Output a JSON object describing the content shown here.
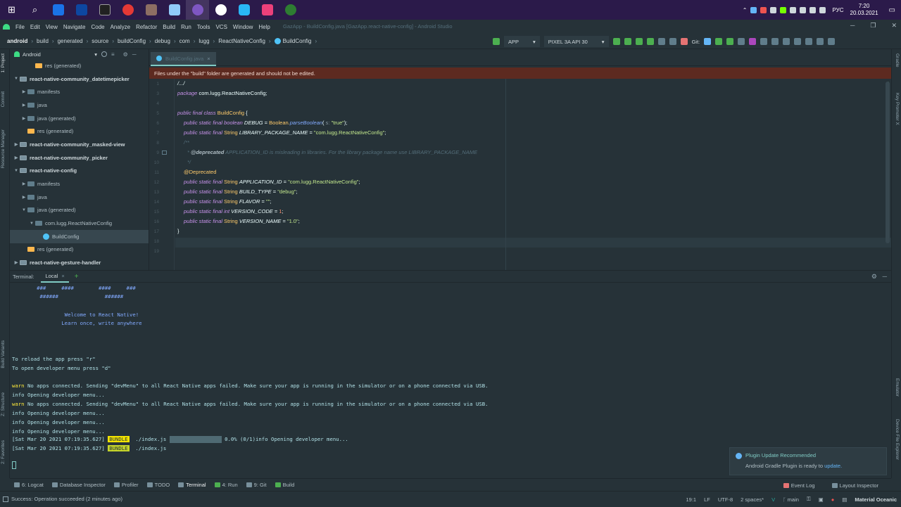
{
  "taskbar": {
    "apps": [
      "windows-start",
      "search",
      "chrome-frame",
      "visual-studio",
      "terminal",
      "chrome",
      "android-studio-2",
      "photos",
      "android-studio",
      "yandex-browser",
      "skype",
      "game-app",
      "chrome-green"
    ],
    "language": "РУС",
    "time": "7:20",
    "date": "20.03.2021"
  },
  "menu": {
    "items": [
      "File",
      "Edit",
      "View",
      "Navigate",
      "Code",
      "Analyze",
      "Refactor",
      "Build",
      "Run",
      "Tools",
      "VCS",
      "Window",
      "Help"
    ],
    "window_title": "GazApp - BuildConfig.java [GazApp.react-native-config] - Android Studio"
  },
  "breadcrumb": [
    "android",
    "build",
    "generated",
    "source",
    "buildConfig",
    "debug",
    "com",
    "lugg",
    "ReactNativeConfig",
    "BuildConfig"
  ],
  "toolbar": {
    "run_config": "APP",
    "device": "PIXEL 3A API 30",
    "git_label": "Git:"
  },
  "left_strip": {
    "project": "1: Project",
    "commit": "Commit",
    "resource_manager": "Resource Manager",
    "build_variants": "Build Variants",
    "structure": "Z: Structure",
    "favorites": "2: Favorites"
  },
  "right_strip": {
    "gradle": "Gradle",
    "key_promoter": "Key Promoter X",
    "emulator": "Emulator",
    "device_explorer": "Device File Explorer"
  },
  "project": {
    "view": "Android",
    "tree": [
      {
        "label": "res (generated)",
        "type": "res",
        "level": 2,
        "arrow": ""
      },
      {
        "label": "react-native-community_datetimepicker",
        "type": "mod",
        "level": 0,
        "arrow": "▼",
        "bold": true
      },
      {
        "label": "manifests",
        "type": "folder",
        "level": 1,
        "arrow": "▶"
      },
      {
        "label": "java",
        "type": "folder",
        "level": 1,
        "arrow": "▶"
      },
      {
        "label": "java (generated)",
        "type": "folder",
        "level": 1,
        "arrow": "▶"
      },
      {
        "label": "res (generated)",
        "type": "res",
        "level": 1,
        "arrow": ""
      },
      {
        "label": "react-native-community_masked-view",
        "type": "mod",
        "level": 0,
        "arrow": "▶",
        "bold": true
      },
      {
        "label": "react-native-community_picker",
        "type": "mod",
        "level": 0,
        "arrow": "▶",
        "bold": true
      },
      {
        "label": "react-native-config",
        "type": "mod",
        "level": 0,
        "arrow": "▼",
        "bold": true
      },
      {
        "label": "manifests",
        "type": "folder",
        "level": 1,
        "arrow": "▶"
      },
      {
        "label": "java",
        "type": "folder",
        "level": 1,
        "arrow": "▶"
      },
      {
        "label": "java (generated)",
        "type": "folder",
        "level": 1,
        "arrow": "▼"
      },
      {
        "label": "com.lugg.ReactNativeConfig",
        "type": "folder",
        "level": 2,
        "arrow": "▼"
      },
      {
        "label": "BuildConfig",
        "type": "class",
        "level": 3,
        "arrow": "",
        "selected": true
      },
      {
        "label": "res (generated)",
        "type": "res",
        "level": 1,
        "arrow": ""
      },
      {
        "label": "react-native-gesture-handler",
        "type": "mod",
        "level": 0,
        "arrow": "▶",
        "bold": true
      }
    ]
  },
  "editor": {
    "tab": "BuildConfig.java",
    "banner": "Files under the \"build\" folder are generated and should not be edited.",
    "line_numbers": [
      "1",
      "3",
      "4",
      "5",
      "6",
      "7",
      "8",
      "9",
      "10",
      "11",
      "12",
      "13",
      "14",
      "15",
      "16",
      "17",
      "18",
      "19"
    ],
    "code": {
      "l1": "/.../",
      "package_kw": "package",
      "package_name": " com.lugg.ReactNativeConfig;",
      "class_decl": [
        "public final class ",
        "BuildConfig",
        " {"
      ],
      "debug": [
        "public static final ",
        "boolean ",
        "DEBUG",
        " = ",
        "Boolean.",
        "parseBoolean",
        "( ",
        "s: ",
        "\"true\"",
        ");"
      ],
      "lib_pkg": [
        "public static final ",
        "String ",
        "LIBRARY_PACKAGE_NAME",
        " = ",
        "\"com.lugg.ReactNativeConfig\"",
        ";"
      ],
      "doc_open": "/**",
      "doc_body": [
        "* ",
        "@deprecated",
        " APPLICATION_ID is misleading in libraries. For the library package name use LIBRARY_PACKAGE_NAME"
      ],
      "doc_close": "*/",
      "annotation": "@Deprecated",
      "app_id": [
        "public static final ",
        "String ",
        "APPLICATION_ID",
        " = ",
        "\"com.lugg.ReactNativeConfig\"",
        ";"
      ],
      "build_type": [
        "public static final ",
        "String ",
        "BUILD_TYPE",
        " = ",
        "\"debug\"",
        ";"
      ],
      "flavor": [
        "public static final ",
        "String ",
        "FLAVOR",
        " = ",
        "\"\"",
        ";"
      ],
      "version_code": [
        "public static final ",
        "int ",
        "VERSION_CODE",
        " = ",
        "1",
        ";"
      ],
      "version_name": [
        "public static final ",
        "String ",
        "VERSION_NAME",
        " = ",
        "\"1.0\"",
        ";"
      ],
      "close": "}"
    }
  },
  "terminal": {
    "label": "Terminal:",
    "tab": "Local",
    "ascii1": "        ###     ####        ####     ###",
    "ascii2": "         ######               ######",
    "welcome": "                 Welcome to React Native!",
    "learn": "                Learn once, write anywhere",
    "reload": "To reload the app press \"r\"",
    "devmenu": "To open developer menu press \"d\"",
    "warn_tag": "warn",
    "warn_msg": " No apps connected. Sending \"devMenu\" to all React Native apps failed. Make sure your app is running in the simulator or on a phone connected via USB.",
    "info_open": "info Opening developer menu...",
    "bundle_ts": "[Sat Mar 20 2021 07:19:35.627] ",
    "bundle_tag": "BUNDLE",
    "bundle_file": "  ./index.js ",
    "bundle_progress": "0.0% (0/1)",
    "progress_fraction": 0.0
  },
  "notification": {
    "title": "Plugin Update Recommended",
    "body": "Android Gradle Plugin is ready to ",
    "link": "update."
  },
  "bottom_tabs": [
    {
      "label": "6: Logcat",
      "icon": "logcat-icon"
    },
    {
      "label": "Database Inspector",
      "icon": "database-icon"
    },
    {
      "label": "Profiler",
      "icon": "profiler-icon"
    },
    {
      "label": "TODO",
      "icon": "todo-icon"
    },
    {
      "label": "Terminal",
      "icon": "terminal-icon",
      "active": true
    },
    {
      "label": "4: Run",
      "icon": "run-icon"
    },
    {
      "label": "9: Git",
      "icon": "git-icon"
    },
    {
      "label": "Build",
      "icon": "build-icon"
    }
  ],
  "bottom_right": [
    "Event Log",
    "Layout Inspector"
  ],
  "status": {
    "message": "Success: Operation succeeded (2 minutes ago)",
    "position": "19:1",
    "line_sep": "LF",
    "encoding": "UTF-8",
    "indent": "2 spaces*",
    "branch": "main",
    "theme": "Material Oceanic"
  }
}
